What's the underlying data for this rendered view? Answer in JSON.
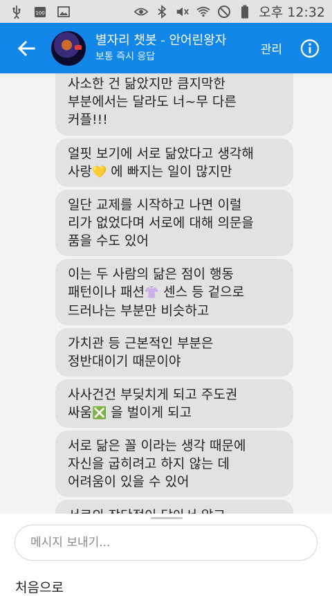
{
  "status_bar": {
    "time": "오후 12:32",
    "battery_level": "100",
    "icons": [
      "usb-icon",
      "battery-100-icon",
      "image-icon",
      "eye-icon",
      "bluetooth-icon",
      "mute-icon",
      "wifi-icon",
      "no-disturb-icon",
      "battery-icon"
    ]
  },
  "header": {
    "title": "별자리 챗봇 - 안어린왕자",
    "subtitle": "보통 즉시 응답",
    "manage_label": "관리",
    "accent_color": "#1387e8"
  },
  "messages": [
    {
      "text": "사소한 건 닮았지만 큼지막한\n부분에서는 달라도 너~무 다른\n커플!!!"
    },
    {
      "text_before": "얼핏 보기에 서로 닮았다고 생각해\n사랑",
      "emoji": "💛",
      "text_after": " 에 빠지는 일이 많지만"
    },
    {
      "text": "일단 교제를 시작하고 나면 이럴\n리가 없었다며 서로에 대해 의문을\n품을 수도 있어"
    },
    {
      "text_before": "이는 두 사람의 닮은 점이 행동\n패턴이나 패션",
      "emoji": "👚",
      "text_after": " 센스 등 겉으로\n드러나는 부분만 비슷하고"
    },
    {
      "text": "가치관 등 근본적인 부분은\n정반대이기 때문이야"
    },
    {
      "text_before": "사사건건 부딪치게 되고 주도권\n싸움",
      "emoji": "❎",
      "text_after": " 을 벌이게 되고"
    },
    {
      "text": "서로  닮은 꼴 이라는 생각 때문에\n자신을 굽히려고 하지 않는 데\n어려움이 있을 수 있어"
    },
    {
      "text": "서로의 장단점이 닮아서 알고"
    }
  ],
  "composer": {
    "placeholder": "메시지 보내기...",
    "to_start_label": "처음으로"
  }
}
